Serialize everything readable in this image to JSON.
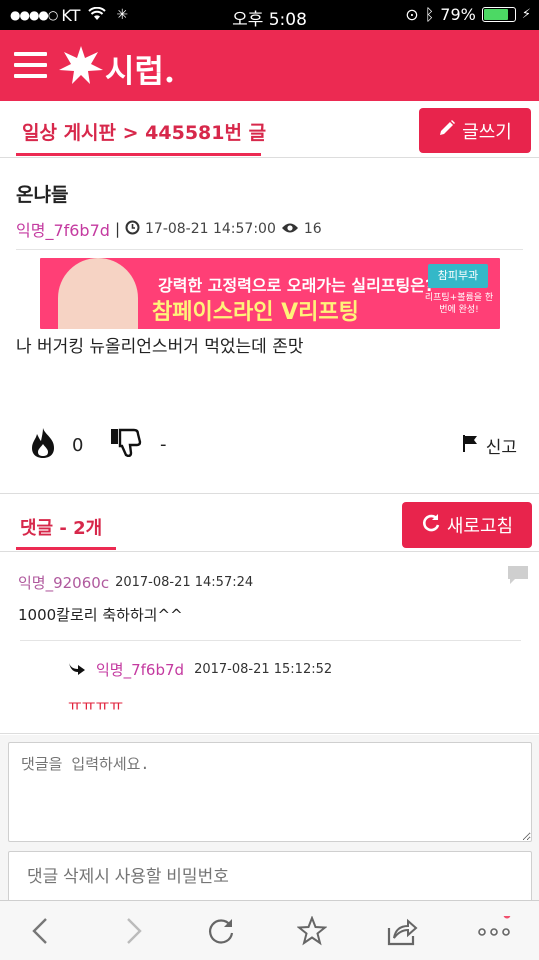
{
  "status_bar": {
    "carrier": "KT",
    "time": "오후 5:08",
    "battery": "79%"
  },
  "app": {
    "logo": "시럽."
  },
  "board": {
    "breadcrumb": "일상 게시판 > 445581번 글",
    "write_label": "글쓰기"
  },
  "post": {
    "title": "온냐들",
    "author": "익명_7f6b7d",
    "datetime": "17-08-21 14:57:00",
    "views": "16",
    "body": "나 버거킹 뉴올리언스버거 먹었는데 존맛",
    "likes": "0",
    "dislikes": "-",
    "report_label": "신고"
  },
  "ad_banner": {
    "line1": "강력한 고정력으로 오래가는 실리프팅은?",
    "line2": "참페이스라인 V리프팅",
    "brand": "참피부과",
    "sub": "리프팅+볼륨을 한번에 완성!"
  },
  "comments": {
    "title": "댓글 - 2개",
    "refresh_label": "새로고침",
    "items": [
      {
        "author": "익명_92060c",
        "datetime": "2017-08-21 14:57:24",
        "body": "1000칼로리 축하하긔^^"
      }
    ],
    "replies": [
      {
        "author": "익명_7f6b7d",
        "datetime": "2017-08-21 15:12:52",
        "body": "ㅠㅠㅠㅠ"
      }
    ]
  },
  "comment_form": {
    "placeholder": "댓글을 입력하세요.",
    "password_placeholder": "댓글 삭제시 사용할 비밀번호"
  },
  "colors": {
    "brand": "#ec2a52",
    "author": "#c43aa0"
  }
}
